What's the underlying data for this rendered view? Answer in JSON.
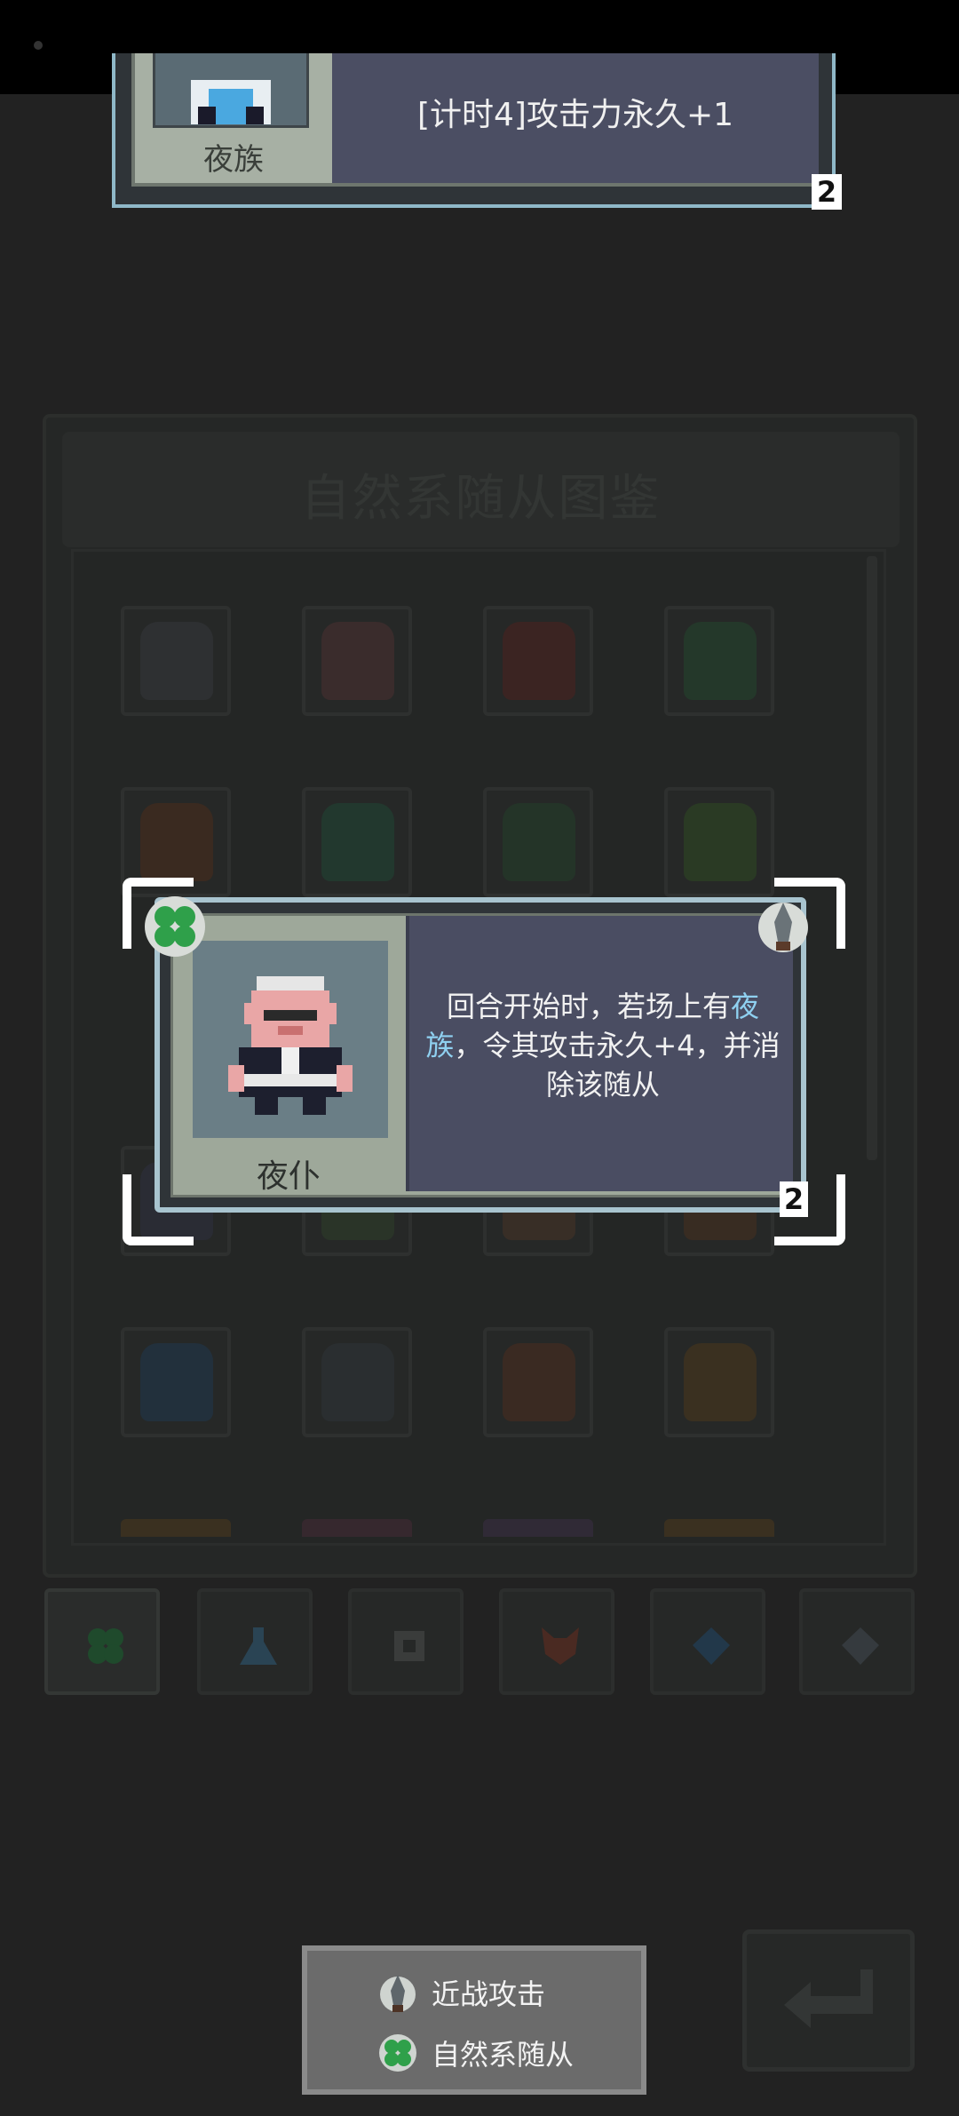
{
  "top_card": {
    "name": "夜族",
    "description": "[计时4]攻击力永久+1",
    "cost": "2"
  },
  "codex": {
    "title": "自然系随从图鉴"
  },
  "popup": {
    "name": "夜仆",
    "desc_prefix": "回合开始时，若场上有",
    "desc_keyword": "夜族",
    "desc_suffix": "，令其攻击永久+4，并消除该随从",
    "cost": "2"
  },
  "legend": {
    "melee_label": "近战攻击",
    "nature_label": "自然系随从"
  },
  "tabs": [
    "nature-tab",
    "potion-tab",
    "mechanic-tab",
    "beast-tab",
    "crystal-tab",
    "diamond-tab"
  ],
  "colors": {
    "keyword": "#8fd0f0",
    "card_border": "#a8c4cf",
    "desc_bg": "#4a4d62",
    "clover": "#2fa04a"
  }
}
